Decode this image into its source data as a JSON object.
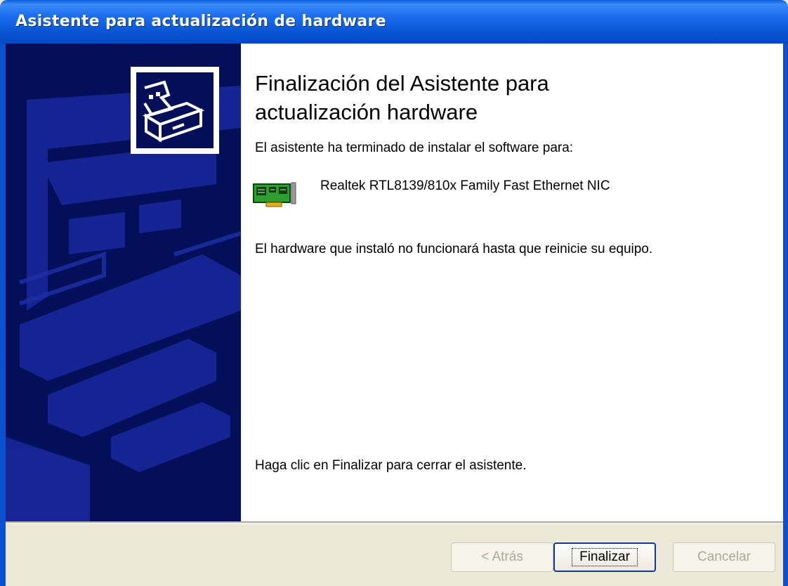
{
  "window": {
    "title": "Asistente para actualización de hardware"
  },
  "sidebar": {
    "logo_icon": "hardware-box-icon",
    "background_color": "#040f5a"
  },
  "content": {
    "heading": "Finalización del Asistente para actualización hardware",
    "intro": "El asistente ha terminado de instalar el software para:",
    "device_icon": "network-card-icon",
    "device_name": "Realtek RTL8139/810x Family Fast Ethernet NIC",
    "note": "El hardware que instaló no funcionará hasta que reinicie su equipo.",
    "finish_text": "Haga clic en Finalizar para cerrar el asistente."
  },
  "buttons": {
    "back": "< Atrás",
    "finish": "Finalizar",
    "cancel": "Cancelar"
  },
  "colors": {
    "titlebar": "#0a58d8",
    "default_button_border": "#16388c",
    "disabled_text": "#aca899"
  }
}
